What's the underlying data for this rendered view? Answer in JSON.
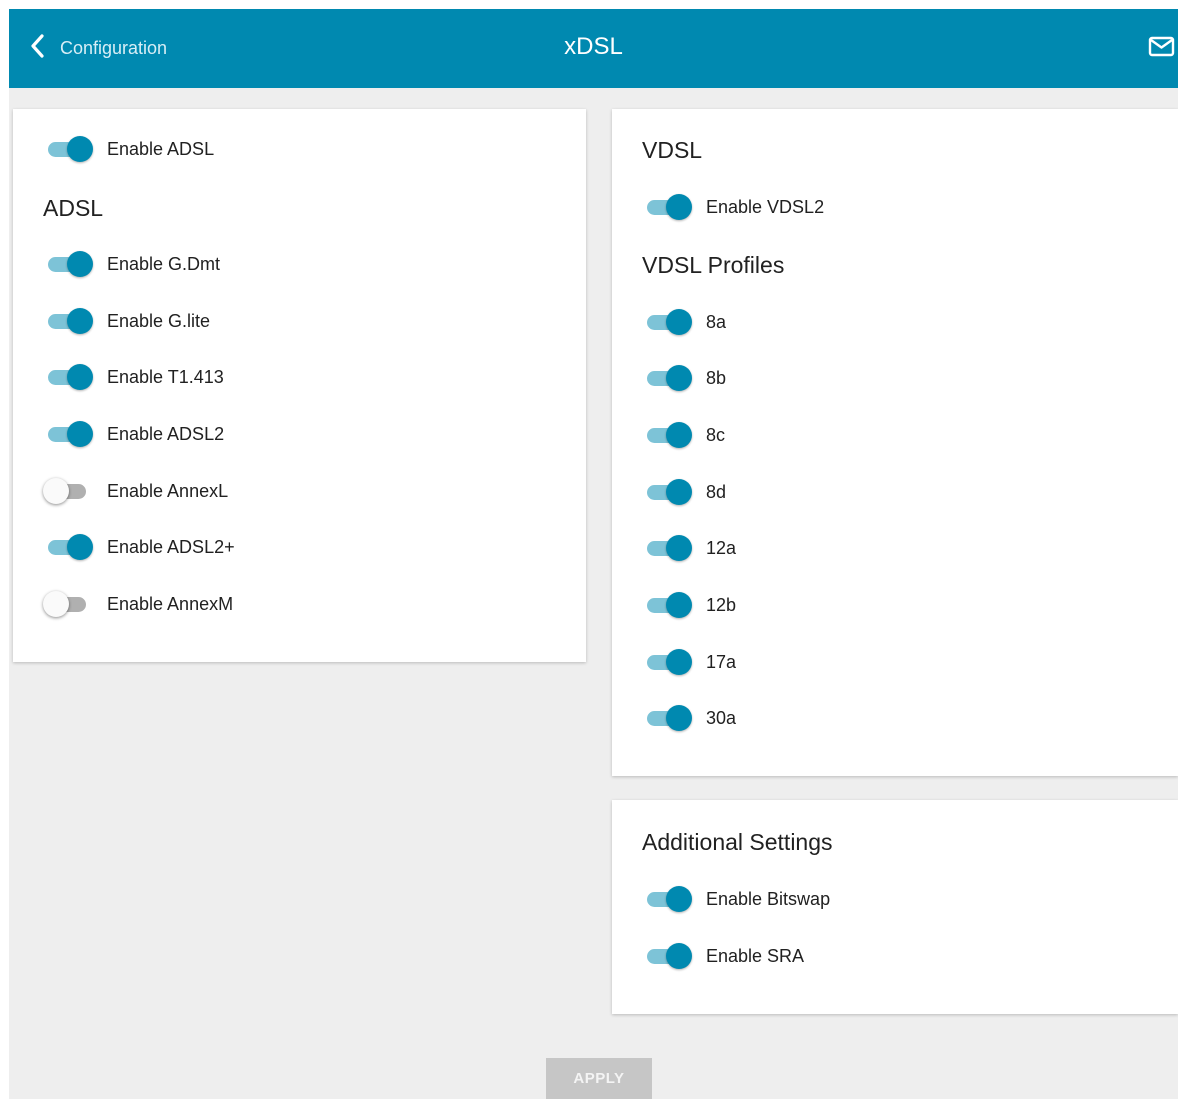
{
  "header": {
    "back_label": "Configuration",
    "title": "xDSL",
    "back_icon": "chevron-left-icon",
    "mail_icon": "mail-icon",
    "color": "#0089b0"
  },
  "adsl_card": {
    "enable_adsl": {
      "label": "Enable ADSL",
      "on": true
    },
    "heading": "ADSL",
    "toggles": [
      {
        "label": "Enable G.Dmt",
        "on": true
      },
      {
        "label": "Enable G.lite",
        "on": true
      },
      {
        "label": "Enable T1.413",
        "on": true
      },
      {
        "label": "Enable ADSL2",
        "on": true
      },
      {
        "label": "Enable AnnexL",
        "on": false
      },
      {
        "label": "Enable ADSL2+",
        "on": true
      },
      {
        "label": "Enable AnnexM",
        "on": false
      }
    ]
  },
  "vdsl_card": {
    "heading": "VDSL",
    "enable_vdsl2": {
      "label": "Enable VDSL2",
      "on": true
    },
    "profiles_heading": "VDSL Profiles",
    "profiles": [
      {
        "label": "8a",
        "on": true
      },
      {
        "label": "8b",
        "on": true
      },
      {
        "label": "8c",
        "on": true
      },
      {
        "label": "8d",
        "on": true
      },
      {
        "label": "12a",
        "on": true
      },
      {
        "label": "12b",
        "on": true
      },
      {
        "label": "17a",
        "on": true
      },
      {
        "label": "30a",
        "on": true
      }
    ]
  },
  "additional_card": {
    "heading": "Additional Settings",
    "toggles": [
      {
        "label": "Enable Bitswap",
        "on": true
      },
      {
        "label": "Enable SRA",
        "on": true
      }
    ]
  },
  "apply_label": "APPLY",
  "colors": {
    "accent": "#0089b0",
    "track_on": "#7dc3d7",
    "track_off": "#b0b0b0",
    "background": "#eeeeee",
    "apply_disabled": "#c6c6c6"
  }
}
